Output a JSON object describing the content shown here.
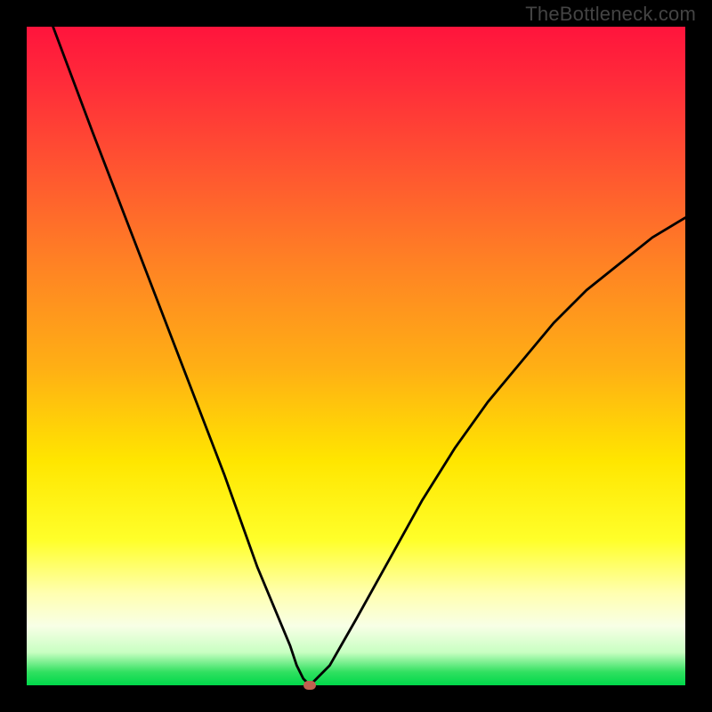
{
  "watermark": "TheBottleneck.com",
  "chart_data": {
    "type": "line",
    "title": "",
    "xlabel": "",
    "ylabel": "",
    "xlim": [
      0,
      100
    ],
    "ylim": [
      0,
      100
    ],
    "series": [
      {
        "name": "curve",
        "x": [
          4,
          10,
          15,
          20,
          25,
          30,
          35,
          40,
          41,
          42,
          43,
          44,
          46,
          50,
          55,
          60,
          65,
          70,
          75,
          80,
          85,
          90,
          95,
          100
        ],
        "y": [
          100,
          84,
          71,
          58,
          45,
          32,
          18,
          6,
          3,
          1,
          0,
          1,
          3,
          10,
          19,
          28,
          36,
          43,
          49,
          55,
          60,
          64,
          68,
          71
        ]
      }
    ],
    "marker": {
      "x": 43,
      "y": 0,
      "color": "#c06050"
    },
    "background_gradient": {
      "top": "#ff143c",
      "bottom": "#00d84a",
      "description": "red-to-green vertical gradient (bottleneck severity)"
    }
  }
}
